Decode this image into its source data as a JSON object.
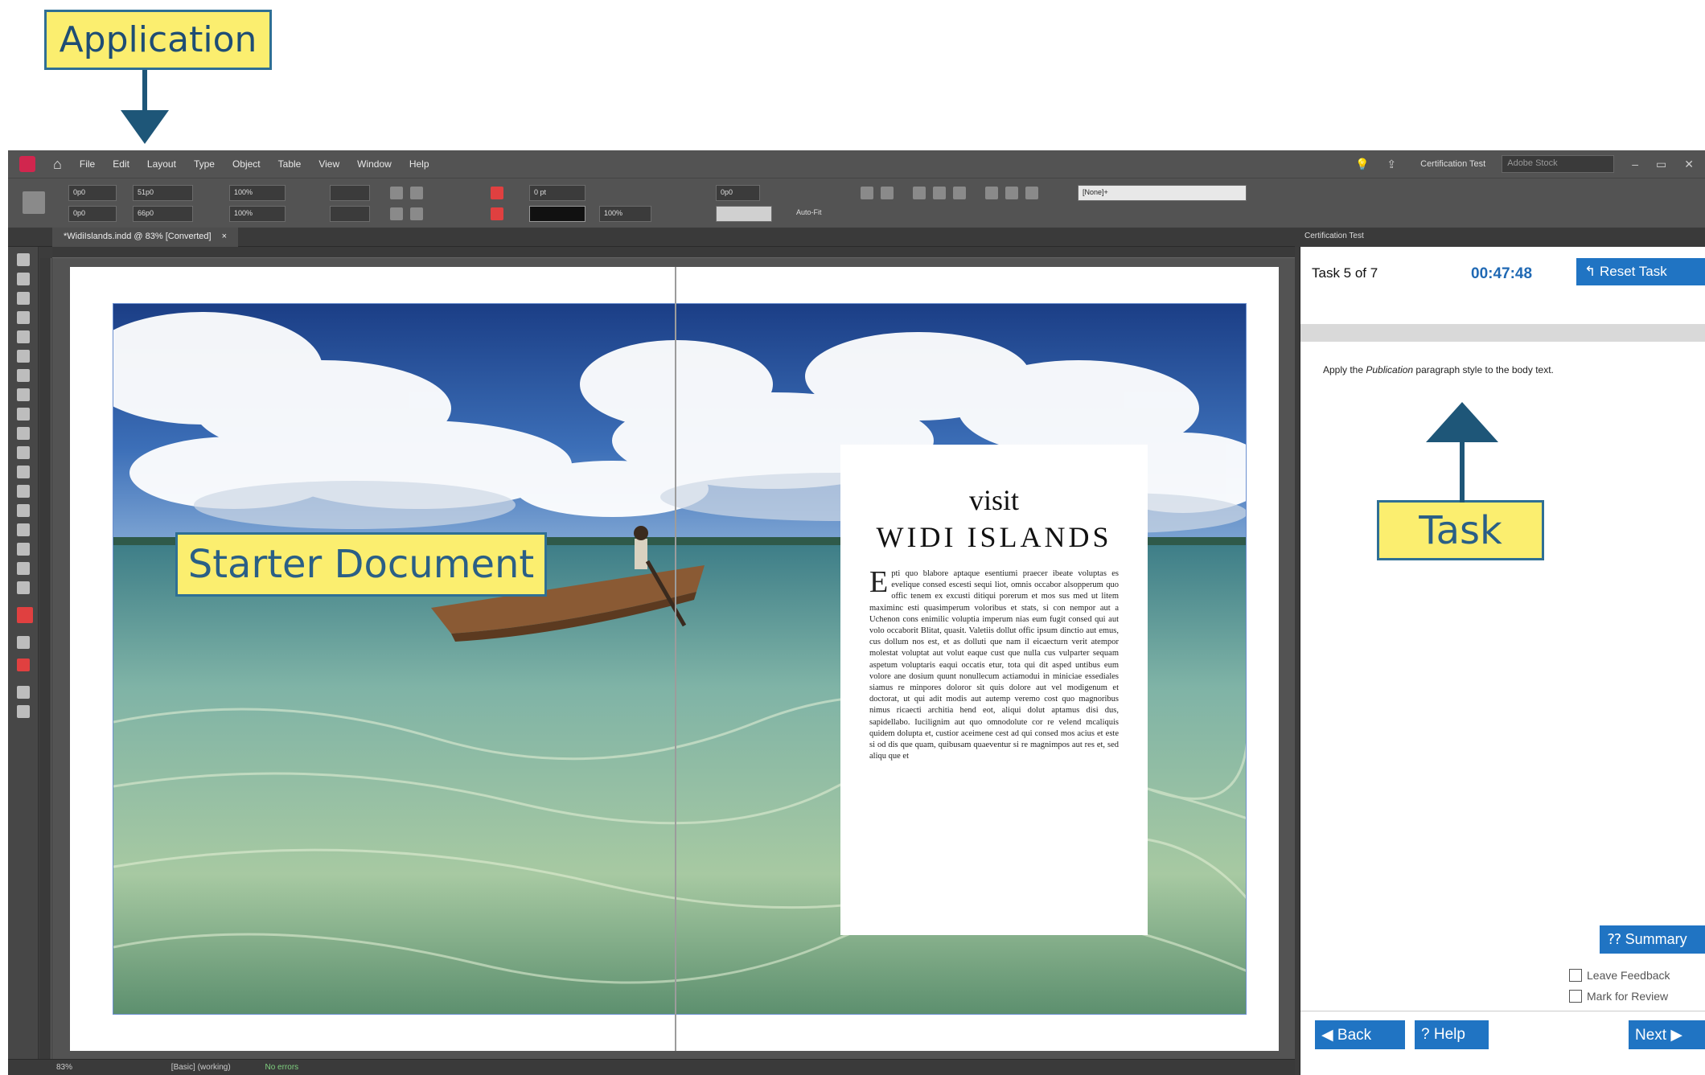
{
  "callouts": {
    "application": "Application",
    "starter_document": "Starter Document",
    "task": "Task"
  },
  "menubar": {
    "items": [
      "File",
      "Edit",
      "Layout",
      "Type",
      "Object",
      "Table",
      "View",
      "Window",
      "Help"
    ],
    "workspace": "Certification Test",
    "search_placeholder": "Adobe Stock"
  },
  "control_bar": {
    "x": "0p0",
    "y": "0p0",
    "w": "51p0",
    "h": "66p0",
    "scale_x": "100%",
    "scale_y": "100%",
    "stroke_weight": "0 pt",
    "zoom_pct": "100%",
    "gap": "0p0",
    "style": "[None]+",
    "auto_fit": "Auto-Fit"
  },
  "document": {
    "tab_title": "*WidiIslands.indd @ 83% [Converted]",
    "close_glyph": "×",
    "heading_small": "visit",
    "heading_large": "WIDI ISLANDS",
    "drop_cap": "E",
    "body_text": "pti quo blabore aptaque esentiumi praecer ibeate voluptas es evelique consed escesti sequi liot, omnis occabor alsopperum quo offic tenem ex excusti ditiqui porerum et mos sus med ut litem maximinc esti quasimperum voloribus et stats, si con nempor aut a Uchenon cons enimilic voluptia imperum nias eum fugit consed qui aut volo occaborit Blitat, quasit. Valetiis dollut offic ipsum dinctio aut emus, cus dollum nos est, et as dolluti que nam il eicaecturn verit atempor molestat voluptat aut volut eaque cust que nulla cus vulparter sequam aspetum voluptaris eaqui occatis etur, tota qui dit asped untibus eum volore ane dosium quunt nonullecum actiamodui in miniciae essediales siamus re minpores doloror sit quis dolore aut vel modigenum et doctorat, ut qui adit modis aut autemp veremo cost quo magnoribus nimus ricaecti architia hend eot, aliqui dolut aptamus disi dus, sapidellabo. Iucilignim aut quo omnodolute cor re velend mcaliquis quidem dolupta et, custior aceimene cest ad qui consed mos acius et este si od dis que quam, quibusam quaeventur si re magnimpos aut res et, sed aliqu que et",
    "status_left": "83%",
    "status_center": "[Basic] (working)",
    "status_errors": "No errors"
  },
  "task_panel": {
    "tab_label": "Certification Test",
    "task_count": "Task 5 of 7",
    "timer": "00:47:48",
    "reset_label": "Reset Task",
    "instruction_prefix": "Apply the ",
    "instruction_emphasis": "Publication",
    "instruction_suffix": " paragraph style to the body text.",
    "summary_label": "Summary",
    "leave_feedback": "Leave Feedback",
    "mark_for_review": "Mark for Review",
    "back_label": "Back",
    "help_label": "Help",
    "next_label": "Next"
  },
  "colors": {
    "callout_fill": "#fbee6f",
    "callout_border": "#2f6f94",
    "arrow": "#1e5678",
    "accent_blue": "#2074c3",
    "app_chrome": "#535353"
  }
}
